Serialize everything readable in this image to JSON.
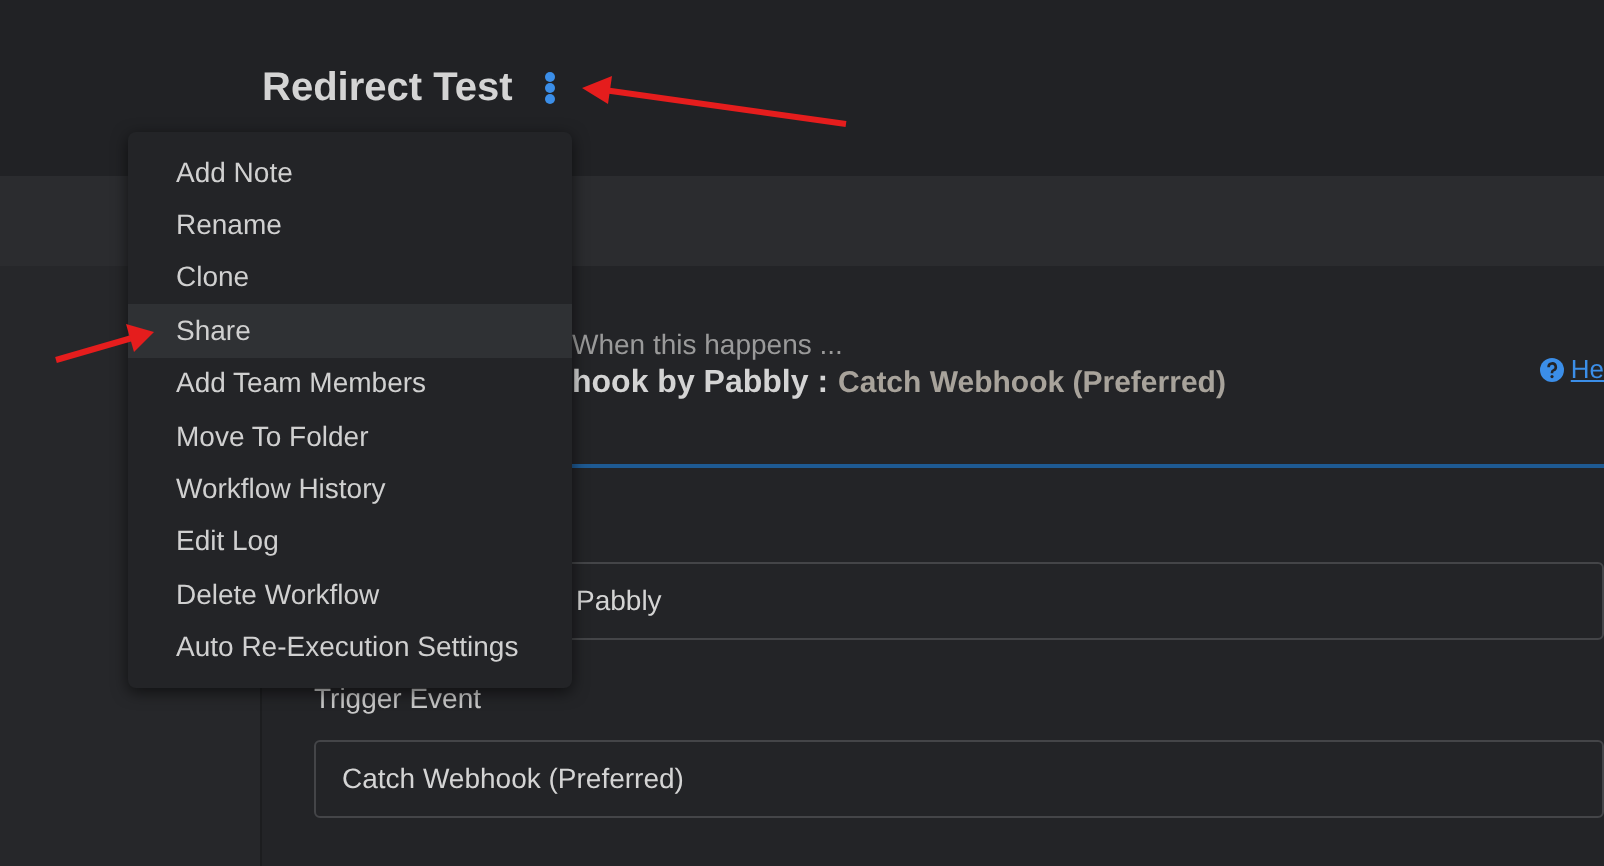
{
  "header": {
    "title": "Redirect Test"
  },
  "menu": {
    "items": [
      {
        "label": "Add Note",
        "selected": false
      },
      {
        "label": "Rename",
        "selected": false
      },
      {
        "label": "Clone",
        "selected": false
      },
      {
        "label": "Share",
        "selected": true
      },
      {
        "label": "Add Team Members",
        "selected": false
      },
      {
        "label": "Move To Folder",
        "selected": false
      },
      {
        "label": "Workflow History",
        "selected": false
      },
      {
        "label": "Edit Log",
        "selected": false
      },
      {
        "label": "Delete Workflow",
        "selected": false
      },
      {
        "label": "Auto Re-Execution Settings",
        "selected": false
      }
    ]
  },
  "trigger": {
    "caption": "When this happens ...",
    "app": "hook by Pabbly :",
    "event": "Catch Webhook (Preferred)",
    "help_link": "He"
  },
  "fields": [
    {
      "value": "Pabbly"
    },
    {
      "label": "Trigger Event",
      "value": "Catch Webhook (Preferred)"
    }
  ]
}
